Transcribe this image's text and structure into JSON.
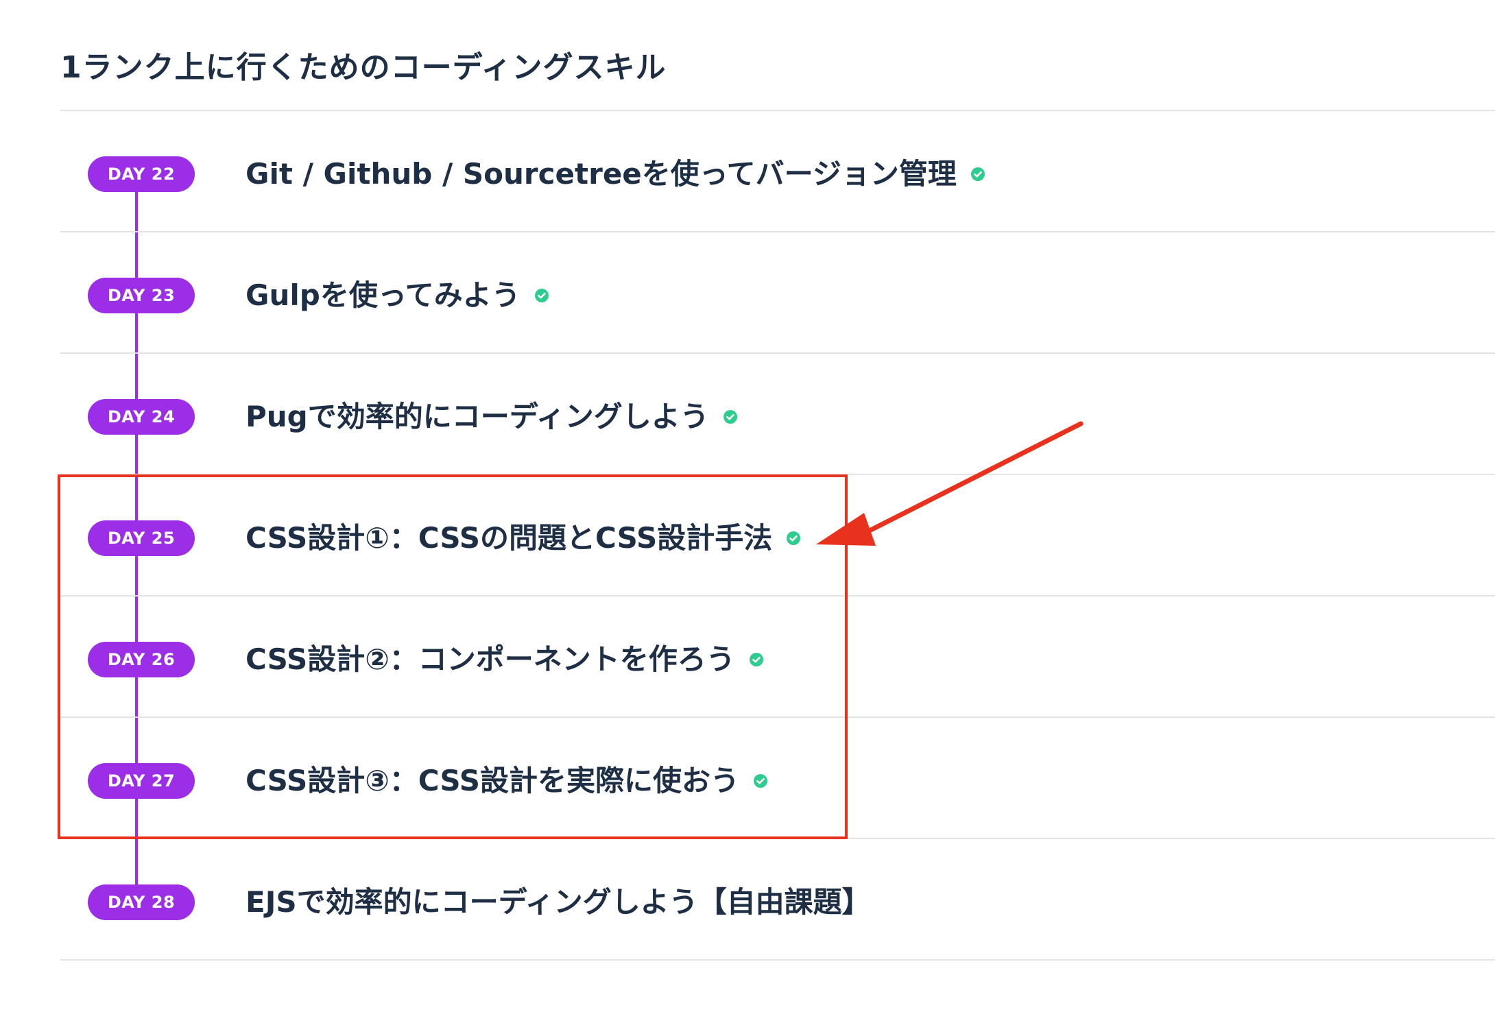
{
  "section": {
    "title": "1ランク上に行くためのコーディングスキル"
  },
  "lessons": [
    {
      "day": "DAY 22",
      "title": "Git / Github / Sourcetreeを使ってバージョン管理",
      "completed": true
    },
    {
      "day": "DAY 23",
      "title": "Gulpを使ってみよう",
      "completed": true
    },
    {
      "day": "DAY 24",
      "title": "Pugで効率的にコーディングしよう",
      "completed": true
    },
    {
      "day": "DAY 25",
      "title": "CSS設計①：CSSの問題とCSS設計手法",
      "completed": true
    },
    {
      "day": "DAY 26",
      "title": "CSS設計②：コンポーネントを作ろう",
      "completed": true
    },
    {
      "day": "DAY 27",
      "title": "CSS設計③：CSS設計を実際に使おう",
      "completed": true
    },
    {
      "day": "DAY 28",
      "title": "EJSで効率的にコーディングしよう【自由課題】",
      "completed": false
    }
  ],
  "icons": {
    "completed": "check-circle-icon"
  },
  "colors": {
    "badge": "#9b2ee6",
    "timeline": "#9b2ee6",
    "check": "#2ecc8f",
    "annotation": "#e8321e",
    "text": "#1e2f45"
  }
}
